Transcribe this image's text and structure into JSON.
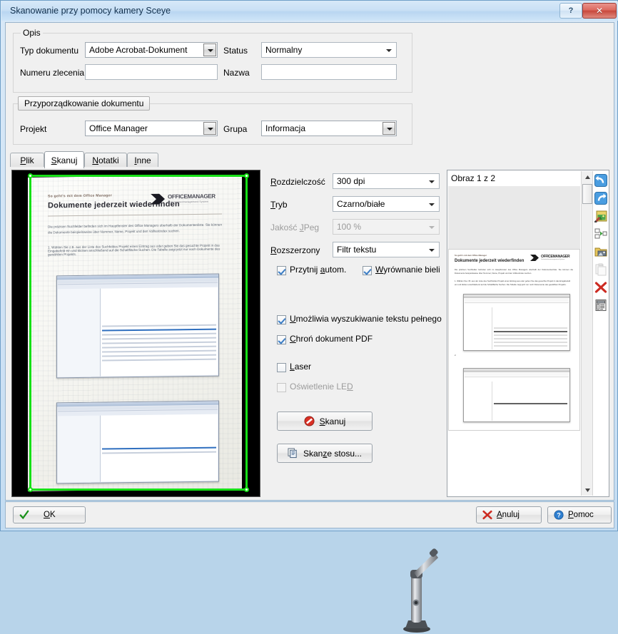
{
  "window": {
    "title": "Skanowanie przy pomocy kamery Sceye",
    "help_button": "?",
    "close_button": "✕"
  },
  "description_group": {
    "legend": "Opis",
    "doc_type_label": "Typ dokumentu",
    "doc_type_value": "Adobe Acrobat-Dokument",
    "status_label": "Status",
    "status_value": "Normalny",
    "order_number_label": "Numeru zlecenia",
    "order_number_value": "",
    "name_label": "Nazwa",
    "name_value": ""
  },
  "assignment_group": {
    "legend": "Przyporządkowanie dokumentu",
    "project_label": "Projekt",
    "project_value": "Office Manager",
    "group_label": "Grupa",
    "group_value": "Informacja"
  },
  "tabs": [
    {
      "label": "Plik",
      "mnemonic": "P",
      "active": false
    },
    {
      "label": "Skanuj",
      "mnemonic": "S",
      "active": true
    },
    {
      "label": "Notatki",
      "mnemonic": "N",
      "active": false
    },
    {
      "label": "Inne",
      "mnemonic": "I",
      "active": false
    }
  ],
  "scan_settings": {
    "resolution_label": "Rozdzielczość",
    "resolution_value": "300 dpi",
    "mode_label": "Tryb",
    "mode_value": "Czarno/białe",
    "jpeg_quality_label": "Jakość JPeg",
    "jpeg_quality_value": "100 %",
    "jpeg_quality_enabled": false,
    "extended_label": "Rozszerzony",
    "extended_value": "Filtr tekstu",
    "checkboxes": [
      {
        "label": "Przytnij autom.",
        "checked": true,
        "enabled": true
      },
      {
        "label": "Wyrównanie bieli",
        "checked": true,
        "enabled": true
      },
      {
        "label": "Umożliwia wyszukiwanie tekstu pełnego",
        "checked": true,
        "enabled": true
      },
      {
        "label": "Chroń dokument PDF",
        "checked": true,
        "enabled": true
      },
      {
        "label": "Laser",
        "checked": false,
        "enabled": true
      },
      {
        "label": "Oświetlenie LED",
        "checked": false,
        "enabled": false
      }
    ],
    "scan_button": "Skanuj",
    "batch_scan_button": "Skanze stosu..."
  },
  "camera_preview": {
    "document": {
      "eyebrow": "So geht's mit dem Office Manager",
      "heading": "Dokumente jederzeit wiederfinden",
      "logo_primary": "OFFICE",
      "logo_secondary": "MANAGER",
      "logo_tagline": "Dokumentenmanagement-System",
      "paragraph": "Die präzisen Suchfelder befinden sich im Hauptfenster des Office Managers oberhalb der Dokumentenliste. Sie können die Dokumente beispielsweise über Nummer, Name, Projekt und den Volltextindex suchen.",
      "item_1": "1. Wählen Sie z.B. aus der Liste des Suchfeldes Projekt einen Eintrag aus oder geben Sie das gesuchte Projekt in das Eingabefeld ein und klicken anschließend auf die Schaltfläche Suchen. Die Tabelle zeigt jetzt nur noch Dokumente des gewählten Projekts."
    },
    "crop_overlay_color": "#16e016"
  },
  "image_preview": {
    "title": "Obraz 1 z 2",
    "toolbar_icons": [
      "undo-icon",
      "redo-icon",
      "edit-image-icon",
      "split-page-icon",
      "save-image-icon",
      "paste-icon",
      "delete-icon",
      "properties-icon"
    ]
  },
  "footer": {
    "ok_button": "OK",
    "cancel_button": "Anuluj",
    "help_button": "Pomoc"
  },
  "colors": {
    "crop_green": "#16e016",
    "title_blue": "#11304d",
    "close_red": "#c8483c"
  }
}
